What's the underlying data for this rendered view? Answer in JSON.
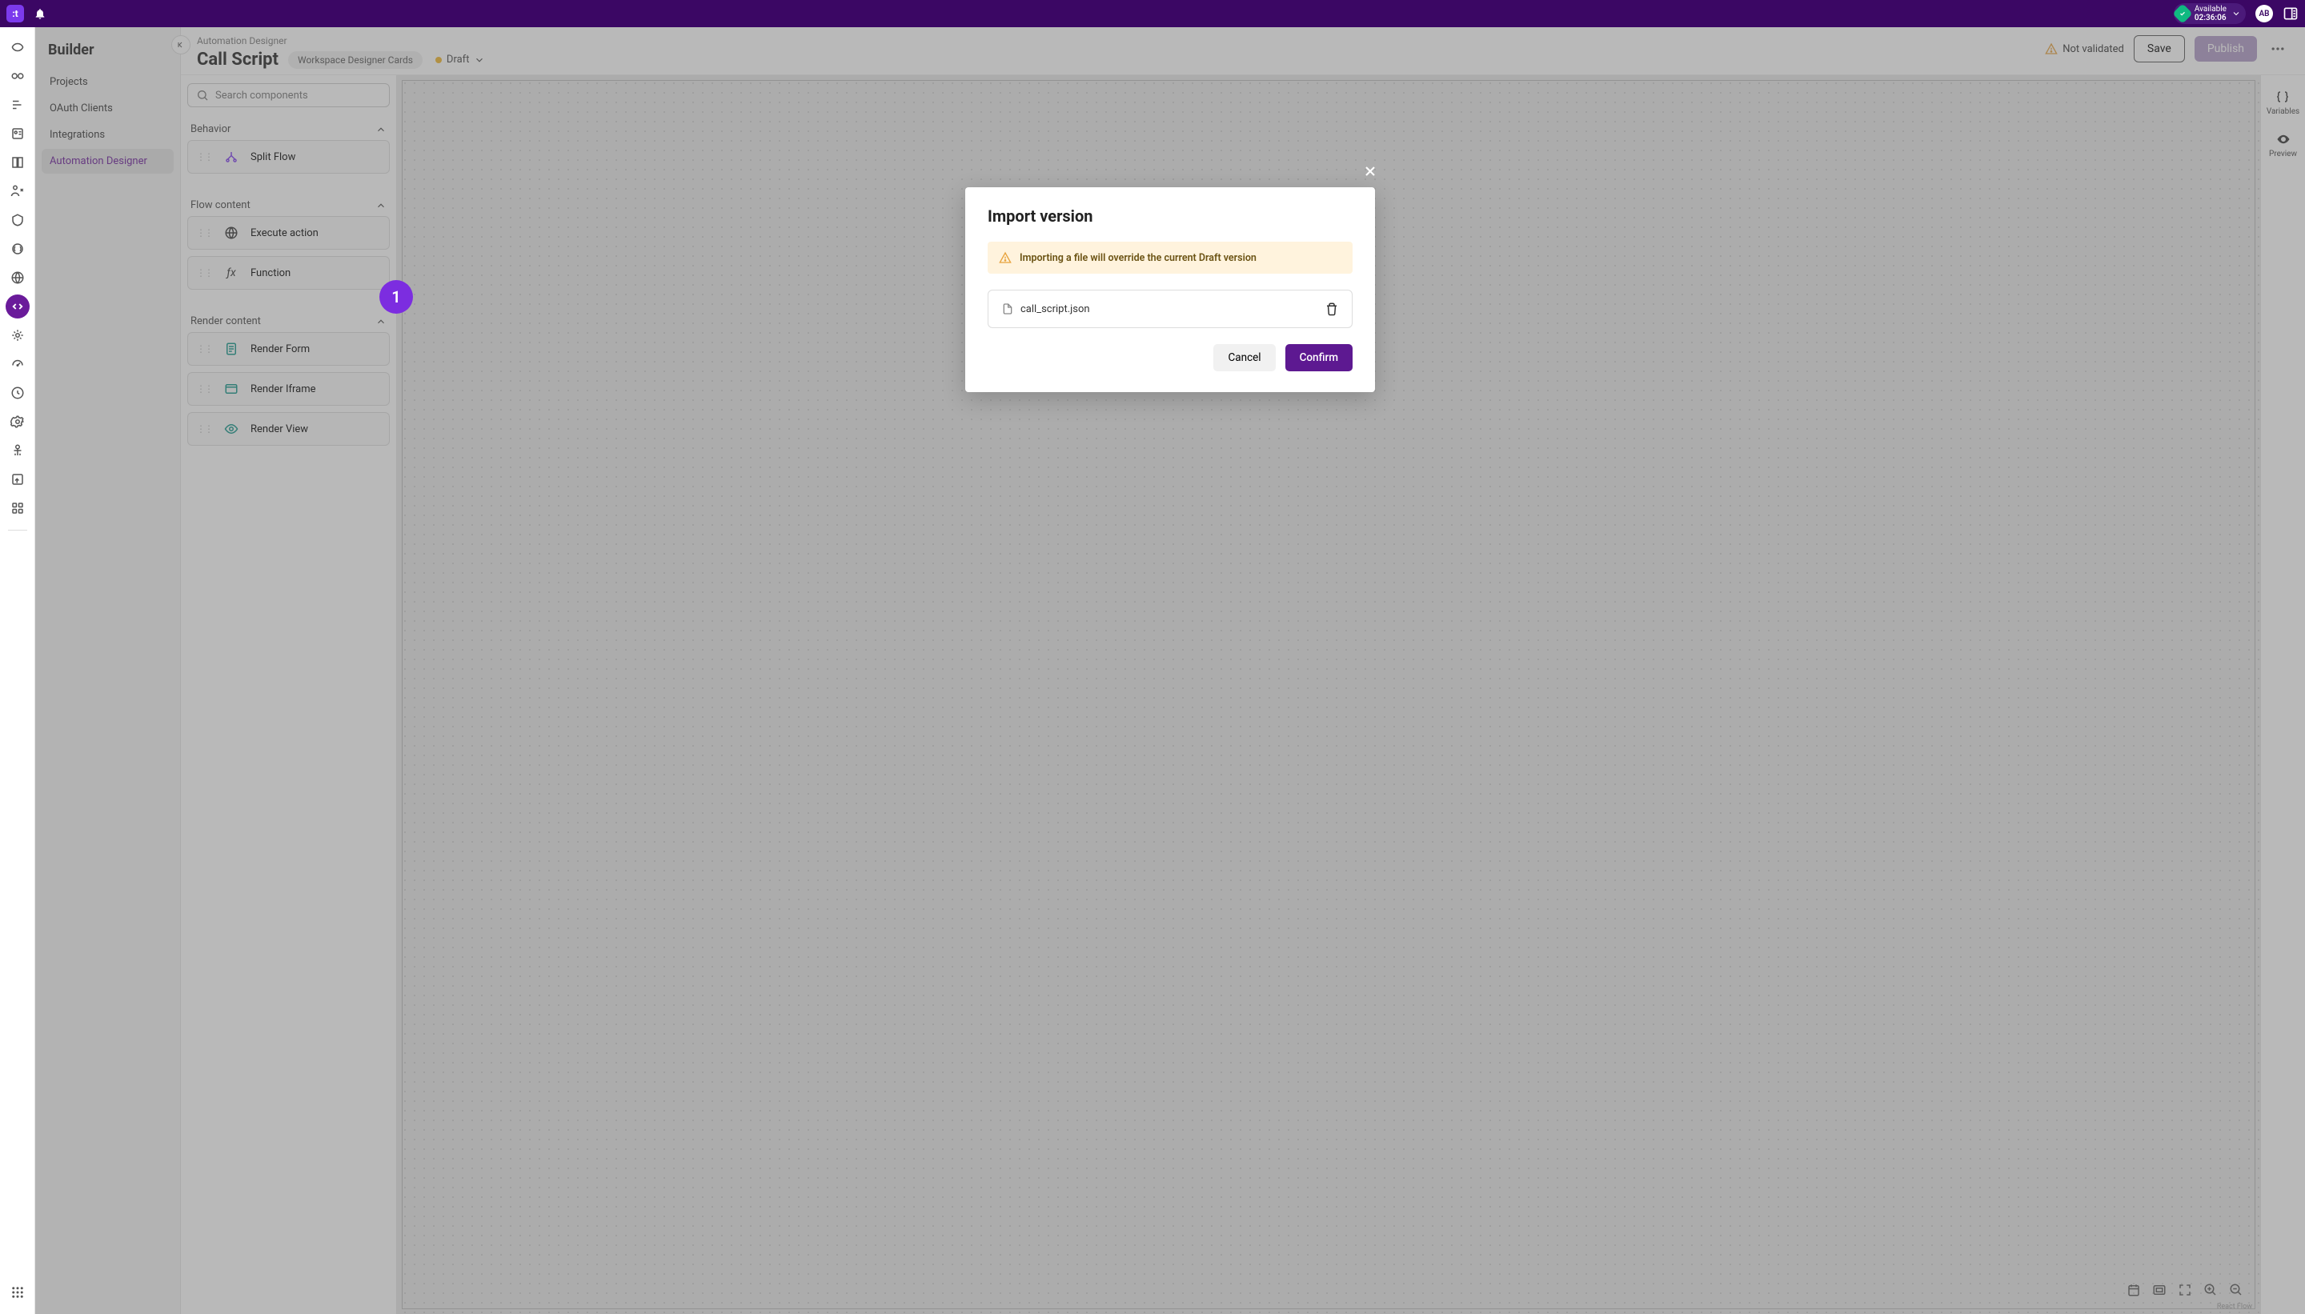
{
  "topbar": {
    "logo_text": ":t",
    "status_label": "Available",
    "status_time": "02:36:06",
    "avatar_initials": "AB"
  },
  "sidebar": {
    "title": "Builder",
    "items": [
      "Projects",
      "OAuth Clients",
      "Integrations",
      "Automation Designer"
    ],
    "active_index": 3
  },
  "header": {
    "breadcrumb": "Automation Designer",
    "title": "Call Script",
    "chip": "Workspace Designer Cards",
    "status": "Draft",
    "not_validated": "Not validated",
    "save": "Save",
    "publish": "Publish"
  },
  "components": {
    "search_placeholder": "Search components",
    "sections": [
      {
        "name": "Behavior",
        "items": [
          "Split Flow"
        ]
      },
      {
        "name": "Flow content",
        "items": [
          "Execute action",
          "Function"
        ]
      },
      {
        "name": "Render content",
        "items": [
          "Render Form",
          "Render Iframe",
          "Render View"
        ]
      }
    ]
  },
  "right_rail": {
    "variables": "Variables",
    "preview": "Preview"
  },
  "canvas": {
    "attribution": "React Flow"
  },
  "modal": {
    "title": "Import version",
    "warning": "Importing a file will override the current Draft version",
    "filename": "call_script.json",
    "cancel": "Cancel",
    "confirm": "Confirm"
  },
  "annotation": {
    "label": "1"
  },
  "colors": {
    "brand": "#3b0764",
    "accent": "#7c3aed",
    "confirm": "#5d1991",
    "warning_bg": "#fff3dd",
    "warning_icon": "#e8a33d"
  }
}
